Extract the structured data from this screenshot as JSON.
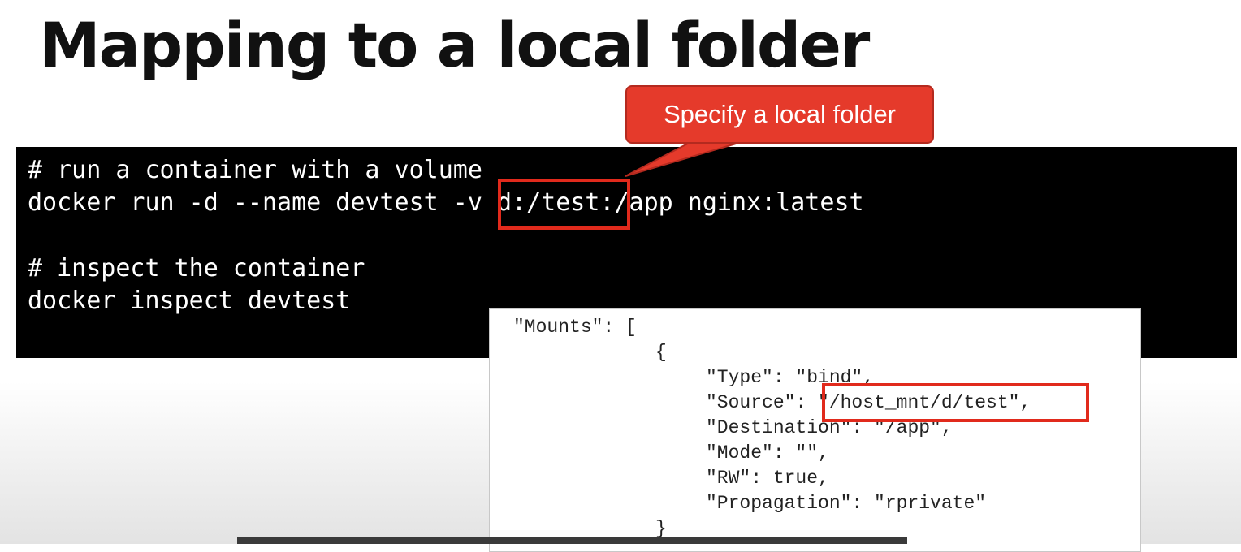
{
  "slide": {
    "title": "Mapping to a local folder"
  },
  "callout": {
    "text": "Specify a local folder"
  },
  "terminal": {
    "lines": [
      "# run a container with a volume",
      "docker run -d --name devtest -v d:/test:/app nginx:latest",
      "",
      "# inspect the container",
      "docker inspect devtest"
    ]
  },
  "inspect_output": {
    "lines": [
      "\"Mounts\": [",
      "{",
      "\"Type\": \"bind\",",
      "\"Source\": \"/host_mnt/d/test\",",
      "\"Destination\": \"/app\",",
      "\"Mode\": \"\",",
      "\"RW\": true,",
      "\"Propagation\": \"rprivate\"",
      "}"
    ]
  },
  "colors": {
    "accent": "#e53a2b",
    "terminal_background": "#000000",
    "terminal_text": "#ffffff"
  }
}
